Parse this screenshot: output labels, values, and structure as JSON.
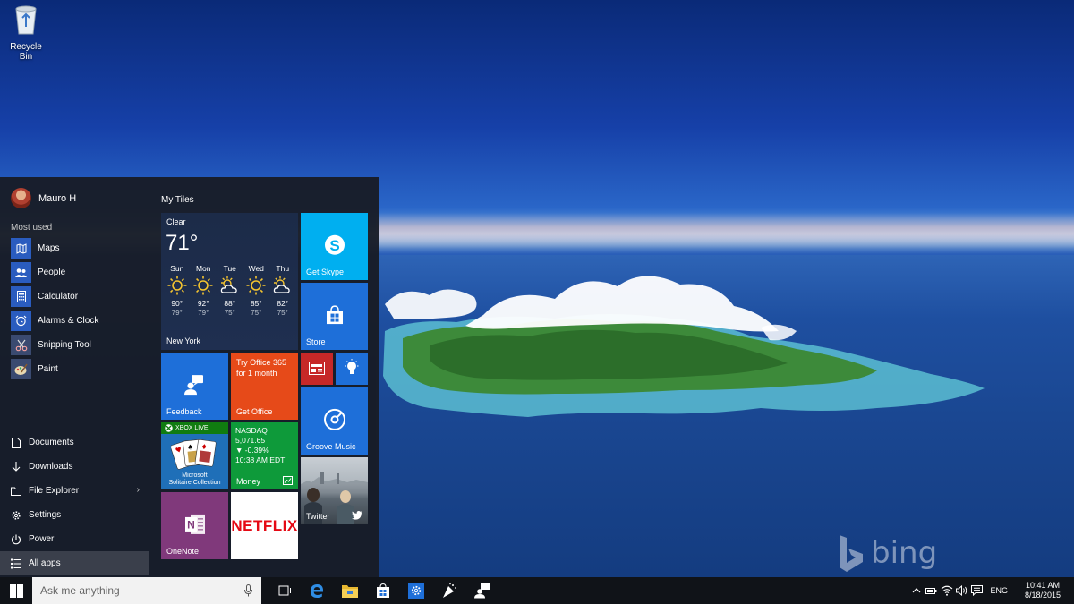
{
  "desktop": {
    "icon_label": "Recycle Bin",
    "watermark": "bing"
  },
  "start_menu": {
    "user_name": "Mauro H",
    "most_used_label": "Most used",
    "most_used": [
      {
        "label": "Maps",
        "icon": "maps-icon"
      },
      {
        "label": "People",
        "icon": "people-icon"
      },
      {
        "label": "Calculator",
        "icon": "calculator-icon"
      },
      {
        "label": "Alarms & Clock",
        "icon": "alarm-clock-icon"
      },
      {
        "label": "Snipping Tool",
        "icon": "scissors-icon"
      },
      {
        "label": "Paint",
        "icon": "palette-icon"
      }
    ],
    "places": [
      {
        "label": "Documents",
        "icon": "document-icon"
      },
      {
        "label": "Downloads",
        "icon": "download-icon"
      },
      {
        "label": "File Explorer",
        "icon": "folder-icon"
      },
      {
        "label": "Settings",
        "icon": "gear-icon"
      },
      {
        "label": "Power",
        "icon": "power-icon"
      },
      {
        "label": "All apps",
        "icon": "list-icon"
      }
    ],
    "tiles_group": "My Tiles",
    "weather": {
      "condition": "Clear",
      "temp": "71°",
      "city": "New York",
      "days": [
        {
          "day": "Sun",
          "hi": "90°",
          "lo": "79°",
          "icon": "sun-icon"
        },
        {
          "day": "Mon",
          "hi": "92°",
          "lo": "79°",
          "icon": "sun-icon"
        },
        {
          "day": "Tue",
          "hi": "88°",
          "lo": "75°",
          "icon": "partly-cloudy-icon"
        },
        {
          "day": "Wed",
          "hi": "85°",
          "lo": "75°",
          "icon": "sun-icon"
        },
        {
          "day": "Thu",
          "hi": "82°",
          "lo": "75°",
          "icon": "partly-cloudy-icon"
        }
      ]
    },
    "tiles": {
      "skype": "Get Skype",
      "store": "Store",
      "feedback": "Feedback",
      "office_line1": "Try Office 365",
      "office_line2": "for 1 month",
      "office": "Get Office",
      "groove": "Groove Music",
      "xbox_live": "XBOX LIVE",
      "solitaire_line1": "Microsoft",
      "solitaire_line2": "Solitaire Collection",
      "money_index": "NASDAQ",
      "money_value": "5,071.65",
      "money_change": "▼ -0.39%",
      "money_time": "10:38 AM EDT",
      "money": "Money",
      "twitter": "Twitter",
      "onenote": "OneNote",
      "netflix": "NETFLIX"
    }
  },
  "taskbar": {
    "search_placeholder": "Ask me anything",
    "language": "ENG",
    "time": "10:41 AM",
    "date": "8/18/2015"
  },
  "colors": {
    "accent": "#1e6fd9",
    "start_bg": "#181c26",
    "taskbar_bg": "#101318",
    "office": "#e64a19",
    "money": "#0e9a3a",
    "onenote": "#80397b",
    "netflix_red": "#e50914",
    "skype": "#00aff0"
  }
}
